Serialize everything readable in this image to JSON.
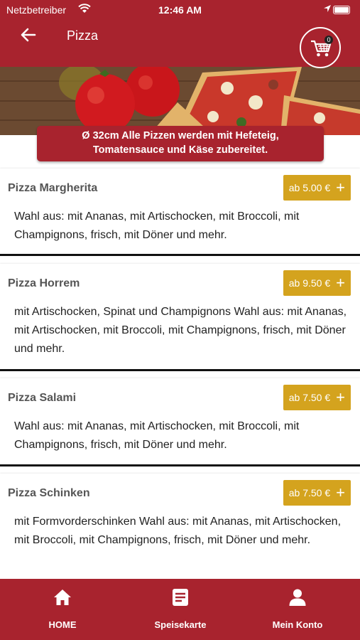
{
  "status_bar": {
    "carrier": "Netzbetreiber",
    "time": "12:46 AM"
  },
  "header": {
    "title": "Pizza",
    "cart_count": "0"
  },
  "notice": {
    "line1": "Ø 32cm Alle Pizzen werden mit Hefeteig,",
    "line2": "Tomatensauce und Käse zubereitet."
  },
  "items": [
    {
      "name": "Pizza Margherita",
      "price": "ab 5.00 €",
      "description": "Wahl aus: mit Ananas, mit Artischocken, mit Broccoli, mit Champignons, frisch, mit Döner und mehr."
    },
    {
      "name": "Pizza Horrem",
      "price": "ab 9.50 €",
      "description": "mit Artischocken, Spinat und Champignons Wahl aus: mit Ananas, mit Artischocken, mit Broccoli, mit Champignons, frisch, mit Döner und mehr."
    },
    {
      "name": "Pizza Salami",
      "price": "ab 7.50 €",
      "description": "Wahl aus: mit Ananas, mit Artischocken, mit Broccoli, mit Champignons, frisch, mit Döner und mehr."
    },
    {
      "name": "Pizza Schinken",
      "price": "ab 7.50 €",
      "description": "mit Formvorderschinken Wahl aus: mit Ananas, mit Artischocken, mit Broccoli, mit Champignons, frisch, mit Döner und mehr."
    }
  ],
  "bottom_nav": [
    {
      "label": "HOME",
      "icon": "home-icon"
    },
    {
      "label": "Speisekarte",
      "icon": "menu-icon"
    },
    {
      "label": "Mein Konto",
      "icon": "user-icon"
    }
  ],
  "colors": {
    "brand": "#a8232e",
    "price": "#d4a31e"
  }
}
